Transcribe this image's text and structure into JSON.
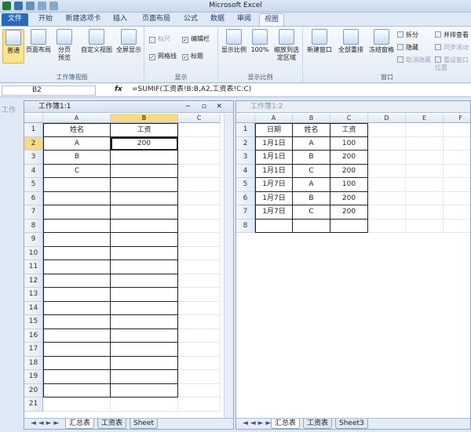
{
  "app": {
    "title": "Microsoft Excel"
  },
  "ribbon": {
    "tabs": [
      "文件",
      "开始",
      "新建选项卡",
      "插入",
      "页面布局",
      "公式",
      "数据",
      "审阅",
      "视图"
    ],
    "groups": {
      "workbook_views": {
        "label": "工作簿视图",
        "normal": "普通",
        "page_layout": "页面布局",
        "page_break": "分页预览",
        "custom_view": "自定义视图",
        "full_screen": "全屏显示"
      },
      "show": {
        "label": "显示",
        "ruler": "标尺",
        "formula_bar": "编辑栏",
        "gridlines": "网格线",
        "headings": "标题"
      },
      "zoom": {
        "label": "显示比例",
        "zoom": "显示比例",
        "hundred": "100%",
        "zoom_selection": "缩放到选定区域"
      },
      "window": {
        "label": "窗口",
        "new_window": "新建窗口",
        "arrange_all": "全部重排",
        "freeze": "冻结窗格",
        "split": "拆分",
        "hide": "隐藏",
        "unhide": "取消隐藏",
        "side_by_side": "并排查看",
        "sync_scroll": "同步滚动",
        "reset_position": "重设窗口位置"
      }
    }
  },
  "formula_bar": {
    "name_box": "B2",
    "fx": "fx",
    "formula": "=SUMIF(工资表!B:B,A2,工资表!C:C)"
  },
  "window1": {
    "title": "工作簿1:1",
    "behind_label": "工作",
    "columns": [
      "A",
      "B",
      "C"
    ],
    "rows": [
      "1",
      "2",
      "3",
      "4",
      "5",
      "6",
      "7",
      "8",
      "9",
      "10",
      "11",
      "12",
      "13",
      "14",
      "15",
      "16",
      "17",
      "18",
      "19",
      "20",
      "21"
    ],
    "cells": [
      [
        "姓名",
        "工资"
      ],
      [
        "A",
        "200"
      ],
      [
        "B",
        ""
      ],
      [
        "C",
        ""
      ]
    ],
    "sheets": [
      "汇总表",
      "工资表",
      "Sheet"
    ]
  },
  "window2": {
    "title": "工作簿1:2",
    "columns": [
      "A",
      "B",
      "C",
      "D",
      "E",
      "F"
    ],
    "rows": [
      "1",
      "2",
      "3",
      "4",
      "5",
      "6",
      "7",
      "8"
    ],
    "cells": [
      [
        "日期",
        "姓名",
        "工资"
      ],
      [
        "1月1日",
        "A",
        "100"
      ],
      [
        "1月1日",
        "B",
        "200"
      ],
      [
        "1月1日",
        "C",
        "200"
      ],
      [
        "1月7日",
        "A",
        "100"
      ],
      [
        "1月7日",
        "B",
        "200"
      ],
      [
        "1月7日",
        "C",
        "200"
      ]
    ],
    "sheets": [
      "汇总表",
      "工资表",
      "Sheet3"
    ]
  }
}
